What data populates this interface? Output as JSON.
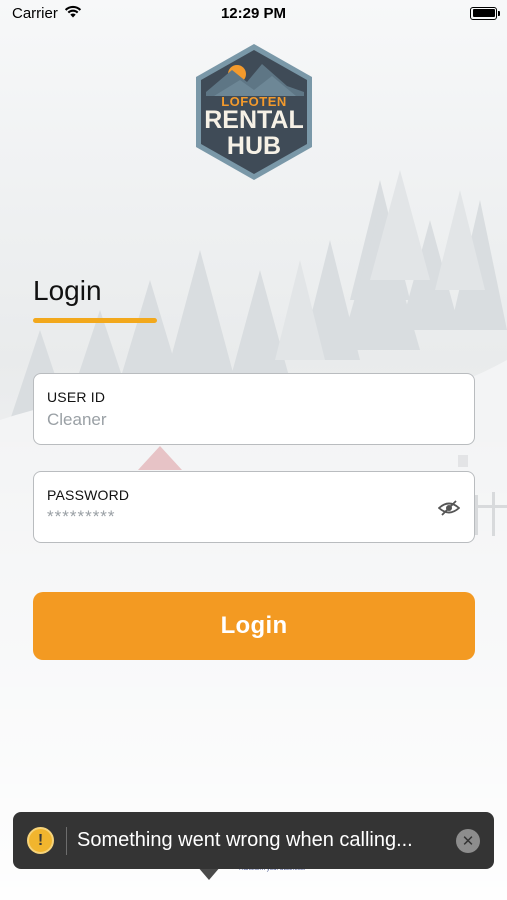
{
  "status_bar": {
    "carrier": "Carrier",
    "time": "12:29 PM"
  },
  "logo": {
    "line1": "LOFOTEN",
    "line2": "RENTAL",
    "line3": "HUB",
    "colors": {
      "badge": "#3f4b57",
      "border": "#7a98a8",
      "sun": "#f39a2c"
    }
  },
  "login_heading": "Login",
  "user_field": {
    "label": "USER ID",
    "value": "Cleaner"
  },
  "password_field": {
    "label": "PASSWORD",
    "value": "*********",
    "icon": "eye-slash-icon"
  },
  "login_button": "Login",
  "toast": {
    "message": "Something went wrong when calling...",
    "icon": "warning-icon",
    "close_icon": "close-icon"
  },
  "footer_tagline": "Transform your business.",
  "colors": {
    "accent": "#f39a22",
    "underline": "#f2a81c",
    "toast_bg": "#343434"
  }
}
